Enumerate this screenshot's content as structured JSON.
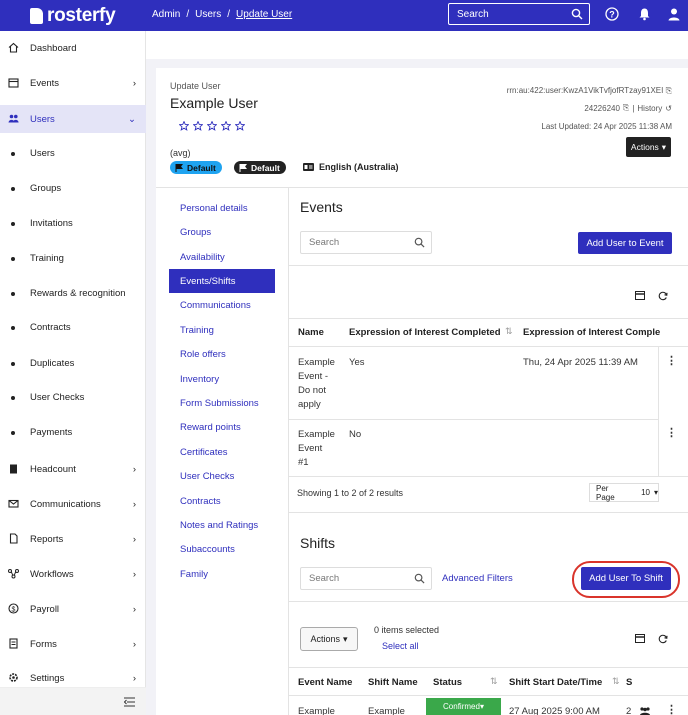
{
  "app": {
    "brand": "rosterfy"
  },
  "breadcrumb": {
    "admin": "Admin",
    "sep1": "/",
    "users": "Users",
    "sep2": "/",
    "current": "Update User"
  },
  "top_search": {
    "placeholder": "Search"
  },
  "sidebar": {
    "dashboard": "Dashboard",
    "events": "Events",
    "users": "Users",
    "users_sub": [
      "Users",
      "Groups",
      "Invitations",
      "Training",
      "Rewards & recognition",
      "Contracts",
      "Duplicates",
      "User Checks",
      "Payments"
    ],
    "headcount": "Headcount",
    "communications": "Communications",
    "reports": "Reports",
    "workflows": "Workflows",
    "payroll": "Payroll",
    "forms": "Forms",
    "settings": "Settings"
  },
  "header": {
    "small": "Update User",
    "name": "Example User",
    "avg": "(avg)",
    "badge1": "Default",
    "badge2": "Default",
    "language": "English (Australia)",
    "urn": "rrn:au:422:user:KwzA1VikTvfjofRTzay91XEI",
    "user_id": "24226240",
    "history": "History",
    "updated": "Last Updated: 24 Apr 2025 11:38 AM",
    "actions": "Actions"
  },
  "left_nav": [
    "Personal details",
    "Groups",
    "Availability",
    "Events/Shifts",
    "Communications",
    "Training",
    "Role offers",
    "Inventory",
    "Form Submissions",
    "Reward points",
    "Certificates",
    "User Checks",
    "Contracts",
    "Notes and Ratings",
    "Subaccounts",
    "Family"
  ],
  "events": {
    "title": "Events",
    "search_placeholder": "Search",
    "add_button": "Add User to Event",
    "columns": [
      "Name",
      "Expression of Interest Completed",
      "Expression of Interest Comple"
    ],
    "rows": [
      {
        "name_lines": [
          "Example",
          "Event -",
          "Do not",
          "apply"
        ],
        "eoi": "Yes",
        "eoi_date": "Thu, 24 Apr 2025 11:39 AM"
      },
      {
        "name_lines": [
          "Example",
          "Event",
          "#1"
        ],
        "eoi": "No",
        "eoi_date": ""
      }
    ],
    "showing": "Showing 1 to 2 of 2 results",
    "per_page_label": "Per Page",
    "per_page_value": "10"
  },
  "shifts": {
    "title": "Shifts",
    "search_placeholder": "Search",
    "advanced_filters": "Advanced Filters",
    "add_button": "Add User To Shift",
    "actions": "Actions",
    "items_selected": "0 items selected",
    "select_all": "Select all",
    "columns": [
      "Event Name",
      "Shift Name",
      "Status",
      "Shift Start Date/Time",
      "S"
    ],
    "row": {
      "event": "Example",
      "shift": "Example",
      "status": "Confirmed",
      "start": "27 Aug 2025 9:00 AM",
      "s": "2"
    }
  },
  "colors": {
    "brand": "#2f2fbd",
    "badge_blue": "#1fa3f0",
    "status_green": "#3aa84a",
    "highlight_ring": "#d9342b"
  }
}
